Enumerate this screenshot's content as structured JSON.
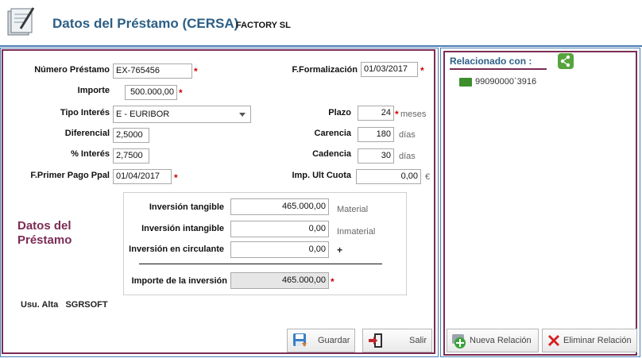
{
  "header": {
    "title": "Datos del Préstamo (CERSA)",
    "company": "FACTORY SL"
  },
  "form": {
    "numero_prestamo": {
      "label": "Número Préstamo",
      "value": "EX-765456"
    },
    "importe": {
      "label": "Importe",
      "value": "500.000,00"
    },
    "tipo_interes": {
      "label": "Tipo Interés",
      "value": "E - EURIBOR"
    },
    "diferencial": {
      "label": "Diferencial",
      "value": "2,5000"
    },
    "pct_interes": {
      "label": "% Interés",
      "value": "2,7500"
    },
    "f_primer_pago": {
      "label": "F.Primer Pago Ppal",
      "value": "01/04/2017"
    },
    "f_formalizacion": {
      "label": "F.Formalización",
      "value": "01/03/2017"
    },
    "plazo": {
      "label": "Plazo",
      "value": "24",
      "unit": "meses"
    },
    "carencia": {
      "label": "Carencia",
      "value": "180",
      "unit": "días"
    },
    "cadencia": {
      "label": "Cadencia",
      "value": "30",
      "unit": "días"
    },
    "imp_ult_cuota": {
      "label": "Imp. Ult Cuota",
      "value": "0,00",
      "unit": "€"
    }
  },
  "inversion": {
    "tangible": {
      "label": "Inversión tangible",
      "value": "465.000,00",
      "note": "Material"
    },
    "intangible": {
      "label": "Inversión intangible",
      "value": "0,00",
      "note": "Inmaterial"
    },
    "circulante": {
      "label": "Inversión en circulante",
      "value": "0,00",
      "note": "+"
    },
    "importe_total": {
      "label": "Importe de la inversión",
      "value": "465.000,00"
    }
  },
  "section_title_line1": "Datos del",
  "section_title_line2": "Préstamo",
  "usu_alta": {
    "label": "Usu. Alta",
    "value": "SGRSOFT"
  },
  "buttons": {
    "guardar": "Guardar",
    "salir": "Salir",
    "nueva_relacion": "Nueva Relación",
    "eliminar_relacion": "Eliminar Relación"
  },
  "relacionado": {
    "title": "Relacionado con :",
    "items": [
      "99090000`3916"
    ]
  },
  "required_mark": "*",
  "colors": {
    "accent": "#2c5f86",
    "panel_border": "#7b2c54",
    "required": "#d00000"
  }
}
